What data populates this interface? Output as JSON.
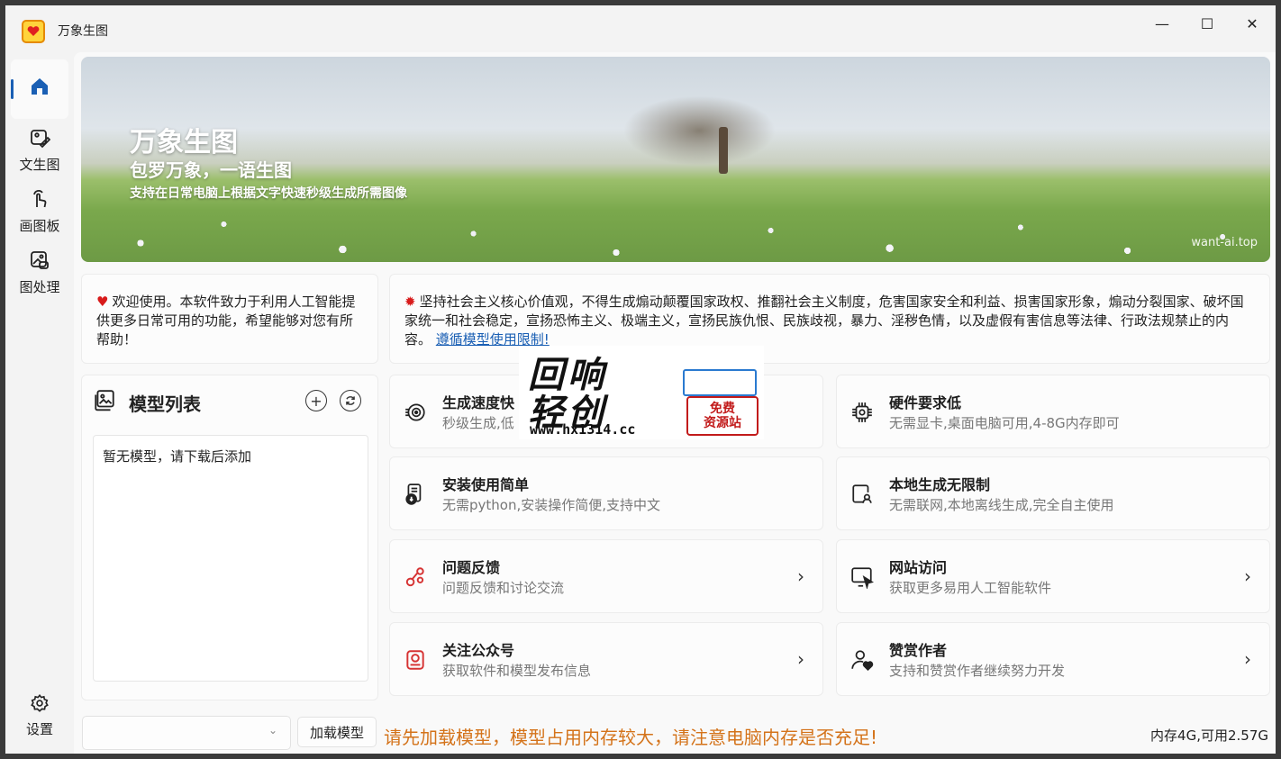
{
  "app": {
    "title": "万象生图",
    "controls": {
      "minimize": "—",
      "maximize": "☐",
      "close": "✕"
    }
  },
  "sidebar": {
    "items": [
      {
        "label": "",
        "icon": "home-icon",
        "active": true
      },
      {
        "label": "文生图",
        "icon": "image-edit-icon",
        "active": false
      },
      {
        "label": "画图板",
        "icon": "hand-draw-icon",
        "active": false
      },
      {
        "label": "图处理",
        "icon": "image-process-icon",
        "active": false
      }
    ],
    "settings_label": "设置"
  },
  "banner": {
    "title": "万象生图",
    "subtitle": "包罗万象，一语生图",
    "description": "支持在日常电脑上根据文字快速秒级生成所需图像",
    "url": "want-ai.top"
  },
  "welcome": {
    "text": "欢迎使用。本软件致力于利用人工智能提供更多日常可用的功能，希望能够对您有所帮助！"
  },
  "notice": {
    "text": "坚持社会主义核心价值观，不得生成煽动颠覆国家政权、推翻社会主义制度，危害国家安全和利益、损害国家形象，煽动分裂国家、破坏国家统一和社会稳定，宣扬恐怖主义、极端主义，宣扬民族仇恨、民族歧视，暴力、淫秽色情，以及虚假有害信息等法律、行政法规禁止的内容。",
    "link": "遵循模型使用限制!"
  },
  "models": {
    "title": "模型列表",
    "add_icon": "add-circle-icon",
    "refresh_icon": "refresh-icon",
    "empty_text": "暂无模型，请下载后添加"
  },
  "features": [
    {
      "title": "生成速度快",
      "desc": "秒级生成,低",
      "icon": "speed-icon",
      "arrow": false
    },
    {
      "title": "硬件要求低",
      "desc": "无需显卡,桌面电脑可用,4-8G内存即可",
      "icon": "chip-icon",
      "arrow": false
    },
    {
      "title": "安装使用简单",
      "desc": "无需python,安装操作简便,支持中文",
      "icon": "install-icon",
      "arrow": false
    },
    {
      "title": "本地生成无限制",
      "desc": "无需联网,本地离线生成,完全自主使用",
      "icon": "local-icon",
      "arrow": false
    },
    {
      "title": "问题反馈",
      "desc": "问题反馈和讨论交流",
      "icon": "feedback-icon",
      "arrow": true
    },
    {
      "title": "网站访问",
      "desc": "获取更多易用人工智能软件",
      "icon": "website-icon",
      "arrow": true
    },
    {
      "title": "关注公众号",
      "desc": "获取软件和模型发布信息",
      "icon": "wechat-icon",
      "arrow": true
    },
    {
      "title": "赞赏作者",
      "desc": "支持和赞赏作者继续努力开发",
      "icon": "donate-icon",
      "arrow": true
    }
  ],
  "bottom": {
    "select_value": "",
    "load_button": "加载模型",
    "warning": "请先加载模型，模型占用内存较大，请注意电脑内存是否充足!",
    "memory": "内存4G,可用2.57G"
  },
  "watermark": {
    "line1": "回响",
    "line2": "轻创",
    "url": "www.hx1314.cc",
    "badge_line1": "免费",
    "badge_line2": "资源站"
  },
  "colors": {
    "accent": "#1a5fb4",
    "warning": "#d4731a",
    "feature_icon": "#d63333"
  }
}
